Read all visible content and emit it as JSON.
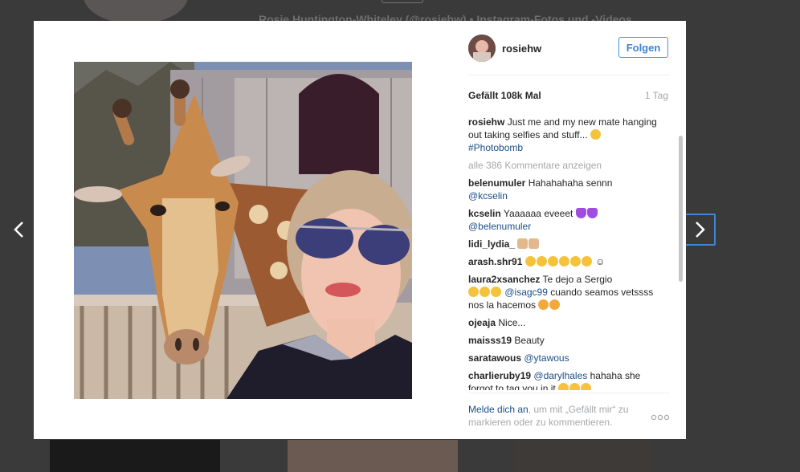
{
  "background": {
    "title_text": "Rosie Huntington-Whiteley (@rosiehw) • Instagram-Fotos und -Videos"
  },
  "post": {
    "username": "rosiehw",
    "follow_label": "Folgen",
    "likes": "Gefällt 108k Mal",
    "time": "1 Tag",
    "caption": {
      "user": "rosiehw",
      "text": "Just me and my new mate hanging out taking selfies and stuff...",
      "hashtag": "#Photobomb"
    },
    "more_comments": "alle 386 Kommentare anzeigen",
    "comments": [
      {
        "user": "belenumuler",
        "text": "Hahahahaha sennn",
        "mention": "@kcselin",
        "after": ""
      },
      {
        "user": "kcselin",
        "text": "Yaaaaaa eveeet",
        "mention": "@belenumuler",
        "after": ""
      },
      {
        "user": "lidi_lydia_",
        "text": "",
        "mention": "",
        "after": ""
      },
      {
        "user": "arash.shr91",
        "text": "",
        "mention": "",
        "after": ""
      },
      {
        "user": "laura2xsanchez",
        "text": "Te dejo a Sergio",
        "mention": "@isagc99",
        "after": "cuando seamos vetssss nos la hacemos"
      },
      {
        "user": "ojeaja",
        "text": "Nice...",
        "mention": "",
        "after": ""
      },
      {
        "user": "maisss19",
        "text": "Beauty",
        "mention": "",
        "after": ""
      },
      {
        "user": "saratawous",
        "text": "",
        "mention": "@ytawous",
        "after": ""
      },
      {
        "user": "charlieruby19",
        "text": "",
        "mention": "@darylhales",
        "after": "hahaha she forgot to tag you in it"
      }
    ],
    "footer": {
      "login_link": "Melde dich an",
      "rest": ", um mit „Gefällt mir“ zu markieren oder zu kommentieren."
    }
  },
  "icons": {
    "prev": "chevron-left-icon",
    "next": "chevron-right-icon",
    "more": "more-dots-icon"
  },
  "colors": {
    "accent": "#3c84d6",
    "link": "#1b4e88",
    "muted": "#a5a7aa"
  }
}
